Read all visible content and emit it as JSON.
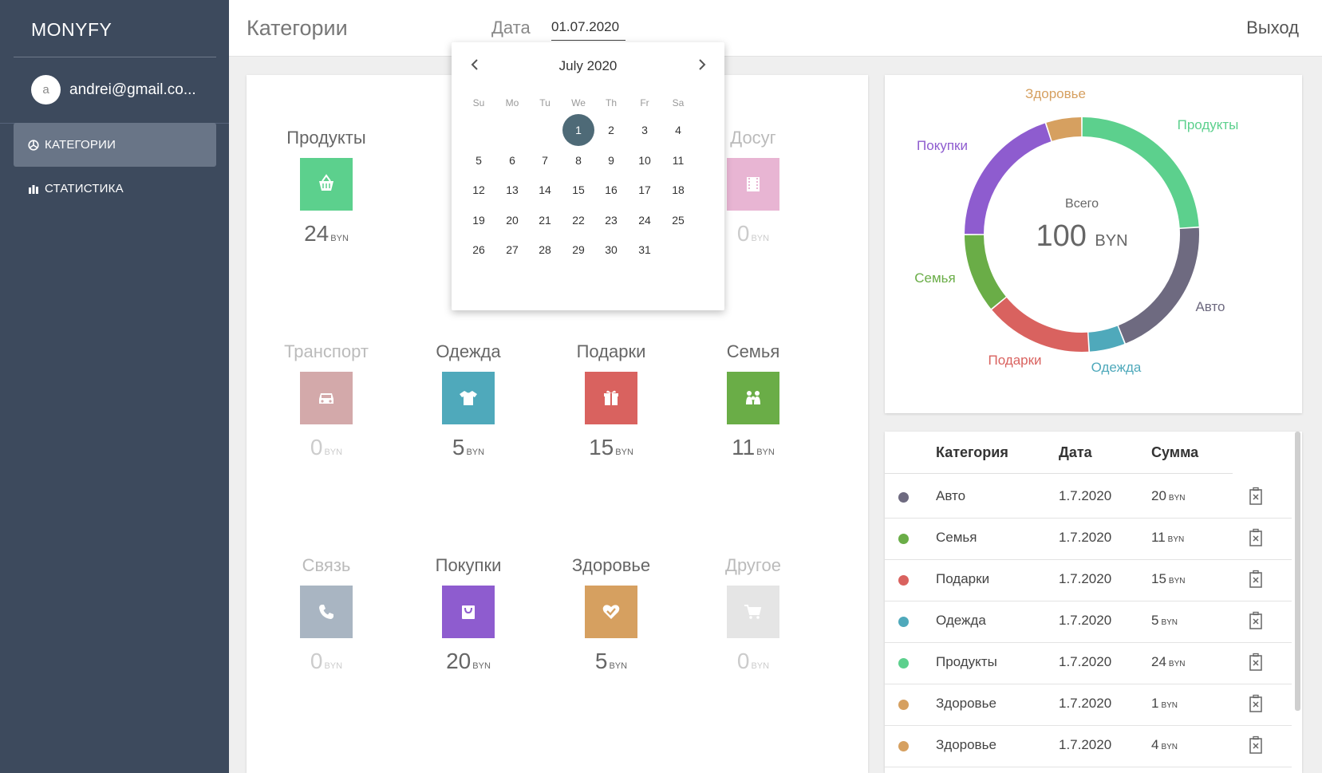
{
  "sidebar": {
    "brand": "MONYFY",
    "user": {
      "avatar_letter": "a",
      "email": "andrei@gmail.co..."
    },
    "nav": [
      {
        "label": "КАТЕГОРИИ",
        "icon": "categories-icon",
        "active": true
      },
      {
        "label": "СТАТИСТИКА",
        "icon": "bar-chart-icon",
        "active": false
      }
    ]
  },
  "header": {
    "title": "Категории",
    "date_label": "Дата",
    "date_value": "01.07.2020",
    "logout": "Выход"
  },
  "calendar": {
    "month": "July 2020",
    "prev_icon": "chevron-left-icon",
    "next_icon": "chevron-right-icon",
    "weekdays": [
      "Su",
      "Mo",
      "Tu",
      "We",
      "Th",
      "Fr",
      "Sa"
    ],
    "first_weekday_index": 3,
    "days_in_month": 31,
    "selected_day": 1
  },
  "categories": [
    {
      "name": "Продукты",
      "amount": "24",
      "currency": "BYN",
      "color": "#5cd08d",
      "icon": "basket-icon",
      "dim": false
    },
    {
      "name": "Досуг",
      "amount": "0",
      "currency": "BYN",
      "color": "#e8b5d3",
      "icon": "film-icon",
      "dim": true
    },
    {
      "name": "Транспорт",
      "amount": "0",
      "currency": "BYN",
      "color": "#d3a9aa",
      "icon": "car-icon",
      "dim": true
    },
    {
      "name": "Одежда",
      "amount": "5",
      "currency": "BYN",
      "color": "#4fa9bb",
      "icon": "tshirt-icon",
      "dim": false
    },
    {
      "name": "Подарки",
      "amount": "15",
      "currency": "BYN",
      "color": "#d9625f",
      "icon": "gift-icon",
      "dim": false
    },
    {
      "name": "Семья",
      "amount": "11",
      "currency": "BYN",
      "color": "#6aad47",
      "icon": "family-icon",
      "dim": false
    },
    {
      "name": "Связь",
      "amount": "0",
      "currency": "BYN",
      "color": "#a9b5c2",
      "icon": "phone-icon",
      "dim": true
    },
    {
      "name": "Покупки",
      "amount": "20",
      "currency": "BYN",
      "color": "#8e5ccf",
      "icon": "shopping-bag-icon",
      "dim": false
    },
    {
      "name": "Здоровье",
      "amount": "5",
      "currency": "BYN",
      "color": "#d6a060",
      "icon": "heart-check-icon",
      "dim": false
    },
    {
      "name": "Другое",
      "amount": "0",
      "currency": "BYN",
      "color": "#e5e5e5",
      "icon": "cart-icon",
      "dim": true
    }
  ],
  "chart_data": {
    "type": "pie",
    "center_label": "Всего",
    "center_value": "100",
    "center_unit": "BYN",
    "slices": [
      {
        "label": "Продукты",
        "value": 24,
        "color": "#5cd08d"
      },
      {
        "label": "Авто",
        "value": 20,
        "color": "#6e6a80"
      },
      {
        "label": "Одежда",
        "value": 5,
        "color": "#4fa9bb"
      },
      {
        "label": "Подарки",
        "value": 15,
        "color": "#d9625f"
      },
      {
        "label": "Семья",
        "value": 11,
        "color": "#6aad47"
      },
      {
        "label": "Покупки",
        "value": 20,
        "color": "#8e5ccf"
      },
      {
        "label": "Здоровье",
        "value": 5,
        "color": "#d6a060"
      }
    ]
  },
  "table": {
    "headers": [
      "Категория",
      "Дата",
      "Сумма"
    ],
    "rows": [
      {
        "category": "Авто",
        "date": "1.7.2020",
        "amount": "20",
        "currency": "BYN",
        "color": "#6e6a80"
      },
      {
        "category": "Семья",
        "date": "1.7.2020",
        "amount": "11",
        "currency": "BYN",
        "color": "#6aad47"
      },
      {
        "category": "Подарки",
        "date": "1.7.2020",
        "amount": "15",
        "currency": "BYN",
        "color": "#d9625f"
      },
      {
        "category": "Одежда",
        "date": "1.7.2020",
        "amount": "5",
        "currency": "BYN",
        "color": "#4fa9bb"
      },
      {
        "category": "Продукты",
        "date": "1.7.2020",
        "amount": "24",
        "currency": "BYN",
        "color": "#5cd08d"
      },
      {
        "category": "Здоровье",
        "date": "1.7.2020",
        "amount": "1",
        "currency": "BYN",
        "color": "#d6a060"
      },
      {
        "category": "Здоровье",
        "date": "1.7.2020",
        "amount": "4",
        "currency": "BYN",
        "color": "#d6a060"
      }
    ],
    "delete_icon": "delete-icon"
  }
}
